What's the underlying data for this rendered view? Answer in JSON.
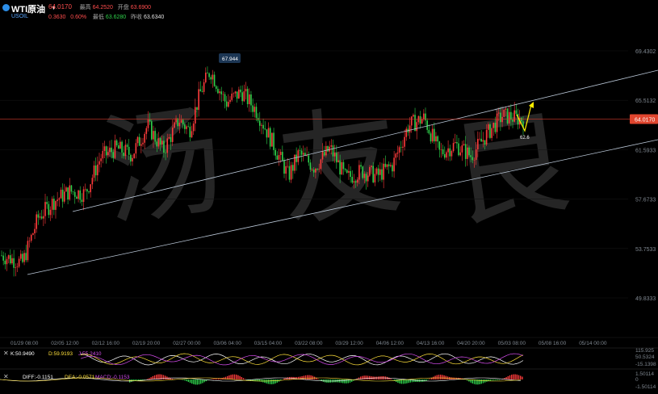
{
  "header": {
    "symbol_name": "WTI原油",
    "symbol_code": "USOIL",
    "last_price": "64.0170",
    "change": "0.3630",
    "change_pct": "0.60%",
    "high_label": "最高",
    "high": "64.2520",
    "open_label": "开盘",
    "open": "63.6900",
    "low_label": "最低",
    "low": "63.6280",
    "prev_close_label": "昨收",
    "prev_close": "63.6340"
  },
  "chart_data": {
    "type": "candlestick",
    "y_ticks": [
      "69.4302",
      "65.5132",
      "61.5933",
      "57.6733",
      "53.7533",
      "49.8333"
    ],
    "y_tick_values": [
      69.4302,
      65.5132,
      61.5933,
      57.6733,
      53.7533,
      49.8333
    ],
    "x_ticks": [
      "01/29 08:00",
      "02/05 12:00",
      "02/12 16:00",
      "02/19 20:00",
      "02/27 00:00",
      "03/06 04:00",
      "03/15 04:00",
      "03/22 08:00",
      "03/29 12:00",
      "04/06 12:00",
      "04/13 16:00",
      "04/20 20:00",
      "05/03 08:00",
      "05/08 16:00",
      "05/14 00:00"
    ],
    "current_price": 64.017,
    "current_price_label": "64.0170",
    "peak_label": "67.944",
    "peak_value": 67.944,
    "target_label": "62.6",
    "target_value": 62.6,
    "trend_channel": {
      "upper": {
        "from": [
          "02/05 12:00",
          58.3
        ],
        "to": [
          "05/14 00:00",
          68.5
        ]
      },
      "lower": {
        "from": [
          "01/29 08:00",
          52.3
        ],
        "to": [
          "05/14 00:00",
          62.9
        ]
      }
    },
    "price_path": [
      {
        "x": 0.0,
        "v": 53.2
      },
      {
        "x": 0.04,
        "v": 52.6
      },
      {
        "x": 0.07,
        "v": 56.2
      },
      {
        "x": 0.1,
        "v": 57.5
      },
      {
        "x": 0.13,
        "v": 58.3
      },
      {
        "x": 0.16,
        "v": 58.1
      },
      {
        "x": 0.19,
        "v": 61.0
      },
      {
        "x": 0.22,
        "v": 61.7
      },
      {
        "x": 0.25,
        "v": 61.2
      },
      {
        "x": 0.28,
        "v": 63.5
      },
      {
        "x": 0.31,
        "v": 61.5
      },
      {
        "x": 0.34,
        "v": 64.0
      },
      {
        "x": 0.36,
        "v": 63.1
      },
      {
        "x": 0.38,
        "v": 66.0
      },
      {
        "x": 0.4,
        "v": 67.9
      },
      {
        "x": 0.43,
        "v": 65.3
      },
      {
        "x": 0.46,
        "v": 66.2
      },
      {
        "x": 0.49,
        "v": 64.6
      },
      {
        "x": 0.52,
        "v": 62.1
      },
      {
        "x": 0.55,
        "v": 59.5
      },
      {
        "x": 0.57,
        "v": 61.3
      },
      {
        "x": 0.6,
        "v": 60.2
      },
      {
        "x": 0.63,
        "v": 61.7
      },
      {
        "x": 0.66,
        "v": 59.3
      },
      {
        "x": 0.69,
        "v": 59.9
      },
      {
        "x": 0.72,
        "v": 59.5
      },
      {
        "x": 0.75,
        "v": 60.4
      },
      {
        "x": 0.78,
        "v": 63.5
      },
      {
        "x": 0.81,
        "v": 64.1
      },
      {
        "x": 0.84,
        "v": 61.3
      },
      {
        "x": 0.87,
        "v": 62.0
      },
      {
        "x": 0.9,
        "v": 61.1
      },
      {
        "x": 0.93,
        "v": 62.8
      },
      {
        "x": 0.96,
        "v": 64.3
      },
      {
        "x": 1.0,
        "v": 64.0
      }
    ],
    "kdj": {
      "label_k": "K:50.9490",
      "label_d": "D:59.9193",
      "label_j": "J:55.2410",
      "axis": [
        "115.925",
        "50.5324",
        "-15.1398"
      ]
    },
    "macd": {
      "label_diff": "DIFF:-0.1151",
      "label_dea": "DEA:-0.0571",
      "label_macd": "MACD:-0.1153",
      "axis": [
        "1.50114",
        "0",
        "-1.50114"
      ]
    }
  },
  "colors": {
    "up": "#ff3b3b",
    "down": "#2fd14b",
    "channel": "#b9c6d6",
    "price_line": "#d33a2c",
    "price_badge": "#e0452e",
    "arrow": "#ffee00",
    "k_line": "#ffffff",
    "d_line": "#ffe03a",
    "j_line": "#d84cf0",
    "axis_text": "#7f8790",
    "watermark": "#2a2a2a"
  },
  "watermark_chars": [
    "汤",
    "友",
    "良"
  ]
}
